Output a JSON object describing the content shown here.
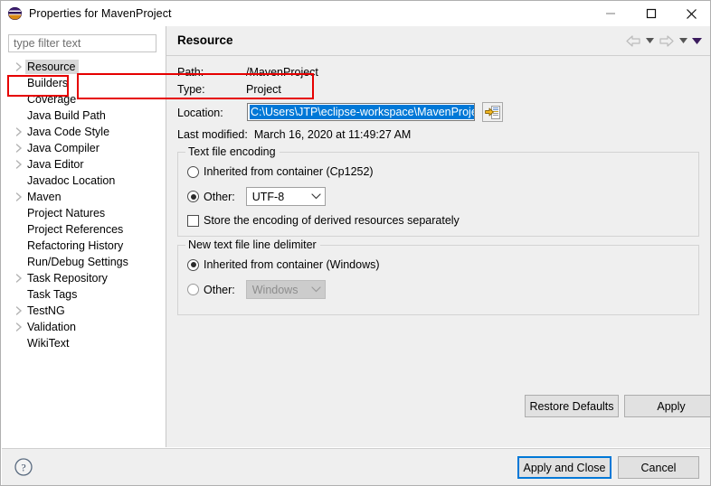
{
  "window": {
    "title": "Properties for MavenProject",
    "icon": "eclipse-logo-icon",
    "controls": {
      "minimize": "minimize-icon",
      "maximize": "maximize-icon",
      "close": "close-icon"
    }
  },
  "sidebar": {
    "filter": {
      "placeholder": "type filter text",
      "value": ""
    },
    "items": [
      {
        "label": "Resource",
        "expandable": true,
        "selected": true
      },
      {
        "label": "Builders",
        "expandable": false,
        "selected": false
      },
      {
        "label": "Coverage",
        "expandable": false,
        "selected": false
      },
      {
        "label": "Java Build Path",
        "expandable": false,
        "selected": false
      },
      {
        "label": "Java Code Style",
        "expandable": true,
        "selected": false
      },
      {
        "label": "Java Compiler",
        "expandable": true,
        "selected": false
      },
      {
        "label": "Java Editor",
        "expandable": true,
        "selected": false
      },
      {
        "label": "Javadoc Location",
        "expandable": false,
        "selected": false
      },
      {
        "label": "Maven",
        "expandable": true,
        "selected": false
      },
      {
        "label": "Project Natures",
        "expandable": false,
        "selected": false
      },
      {
        "label": "Project References",
        "expandable": false,
        "selected": false
      },
      {
        "label": "Refactoring History",
        "expandable": false,
        "selected": false
      },
      {
        "label": "Run/Debug Settings",
        "expandable": false,
        "selected": false
      },
      {
        "label": "Task Repository",
        "expandable": true,
        "selected": false
      },
      {
        "label": "Task Tags",
        "expandable": false,
        "selected": false
      },
      {
        "label": "TestNG",
        "expandable": true,
        "selected": false
      },
      {
        "label": "Validation",
        "expandable": true,
        "selected": false
      },
      {
        "label": "WikiText",
        "expandable": false,
        "selected": false
      }
    ]
  },
  "content": {
    "page_title": "Resource",
    "nav": {
      "back": "back-arrow-icon",
      "back_menu": "back-dropdown-icon",
      "forward": "forward-arrow-icon",
      "forward_menu": "forward-dropdown-icon",
      "menu": "view-menu-icon"
    },
    "fields": {
      "path_label": "Path:",
      "path_value": "/MavenProject",
      "type_label": "Type:",
      "type_value": "Project",
      "location_label": "Location:",
      "location_value": "C:\\Users\\JTP\\eclipse-workspace\\MavenProject",
      "browse_icon": "browse-folder-icon",
      "last_modified_label": "Last modified:",
      "last_modified_value": "March 16, 2020 at 11:49:27 AM"
    },
    "encoding_group": {
      "title": "Text file encoding",
      "inherited_label": "Inherited from container (Cp1252)",
      "inherited_selected": false,
      "other_label": "Other:",
      "other_selected": true,
      "other_value": "UTF-8",
      "store_checkbox_label": "Store the encoding of derived resources separately",
      "store_checked": false
    },
    "delimiter_group": {
      "title": "New text file line delimiter",
      "inherited_label": "Inherited from container (Windows)",
      "inherited_selected": true,
      "other_label": "Other:",
      "other_selected": false,
      "other_value": "Windows",
      "other_disabled": true
    },
    "buttons": {
      "restore_defaults": "Restore Defaults",
      "apply": "Apply"
    }
  },
  "footer": {
    "help": "help-icon",
    "apply_and_close": "Apply and Close",
    "cancel": "Cancel"
  },
  "annotations": {
    "color": "#e60000",
    "boxes": [
      "location-label",
      "location-field"
    ]
  },
  "colors": {
    "selection_blue": "#0078d7",
    "panel_grey": "#efefef",
    "tree_selection_grey": "#d8d8d8"
  }
}
